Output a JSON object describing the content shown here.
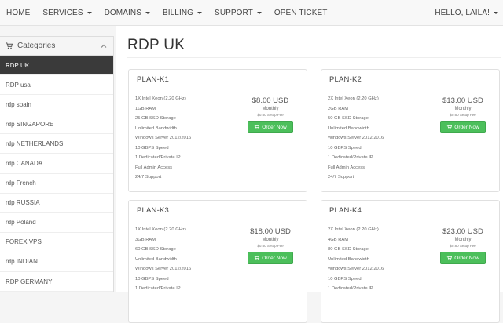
{
  "nav": {
    "home": "HOME",
    "services": "SERVICES",
    "domains": "DOMAINS",
    "billing": "BILLING",
    "support": "SUPPORT",
    "open_ticket": "OPEN TICKET",
    "user": "HELLO, LAILA!"
  },
  "sidebar": {
    "title": "Categories",
    "items": [
      {
        "label": "RDP UK",
        "active": true
      },
      {
        "label": "RDP usa"
      },
      {
        "label": "rdp spain"
      },
      {
        "label": "rdp SINGAPORE"
      },
      {
        "label": "rdp NETHERLANDS"
      },
      {
        "label": "rdp CANADA"
      },
      {
        "label": "rdp French"
      },
      {
        "label": "rdp RUSSIA"
      },
      {
        "label": "rdp Poland"
      },
      {
        "label": "FOREX VPS"
      },
      {
        "label": "rdp INDIAN"
      },
      {
        "label": "RDP GERMANY"
      }
    ]
  },
  "page": {
    "title": "RDP UK"
  },
  "plans": [
    {
      "name": "PLAN-K1",
      "features": [
        "1X Intel Xeon (2.20 GHz)",
        "1GB RAM",
        "25 GB SSD Storage",
        "Unlimited Bandwidth",
        "Windows Server 2012/2016",
        "10 GBPS Speed",
        "1 Dedicated/Private IP",
        "Full Admin Access",
        "24/7 Support"
      ],
      "price": "$8.00 USD",
      "cycle": "Monthly",
      "setup": "$0.60 Setup Fee",
      "order": "Order Now"
    },
    {
      "name": "PLAN-K2",
      "features": [
        "2X Intel Xeon (2.20 GHz)",
        "2GB RAM",
        "50 GB SSD Storage",
        "Unlimited Bandwidth",
        "Windows Server 2012/2016",
        "10 GBPS Speed",
        "1 Dedicated/Private IP",
        "Full Admin Access",
        "24/7 Support"
      ],
      "price": "$13.00 USD",
      "cycle": "Monthly",
      "setup": "$0.60 Setup Fee",
      "order": "Order Now"
    },
    {
      "name": "PLAN-K3",
      "features": [
        "1X Intel Xeon (2.20 GHz)",
        "3GB RAM",
        "60 GB SSD Storage",
        "Unlimited Bandwidth",
        "Windows Server 2012/2016",
        "10 GBPS Speed",
        "1 Dedicated/Private IP"
      ],
      "price": "$18.00 USD",
      "cycle": "Monthly",
      "setup": "$0.60 Setup Fee",
      "order": "Order Now"
    },
    {
      "name": "PLAN-K4",
      "features": [
        "2X Intel Xeon (2.20 GHz)",
        "4GB RAM",
        "80 GB SSD Storage",
        "Unlimited Bandwidth",
        "Windows Server 2012/2016",
        "10 GBPS Speed",
        "1 Dedicated/Private IP"
      ],
      "price": "$23.00 USD",
      "cycle": "Monthly",
      "setup": "$0.80 Setup Fee",
      "order": "Order Now"
    }
  ],
  "colors": {
    "order_button": "#4cbf5b",
    "active_category": "#3a3a3a"
  },
  "icons": {
    "sidebar_head": "shopping-cart-icon",
    "collapse": "chevron-up-icon",
    "order": "shopping-cart-icon"
  }
}
